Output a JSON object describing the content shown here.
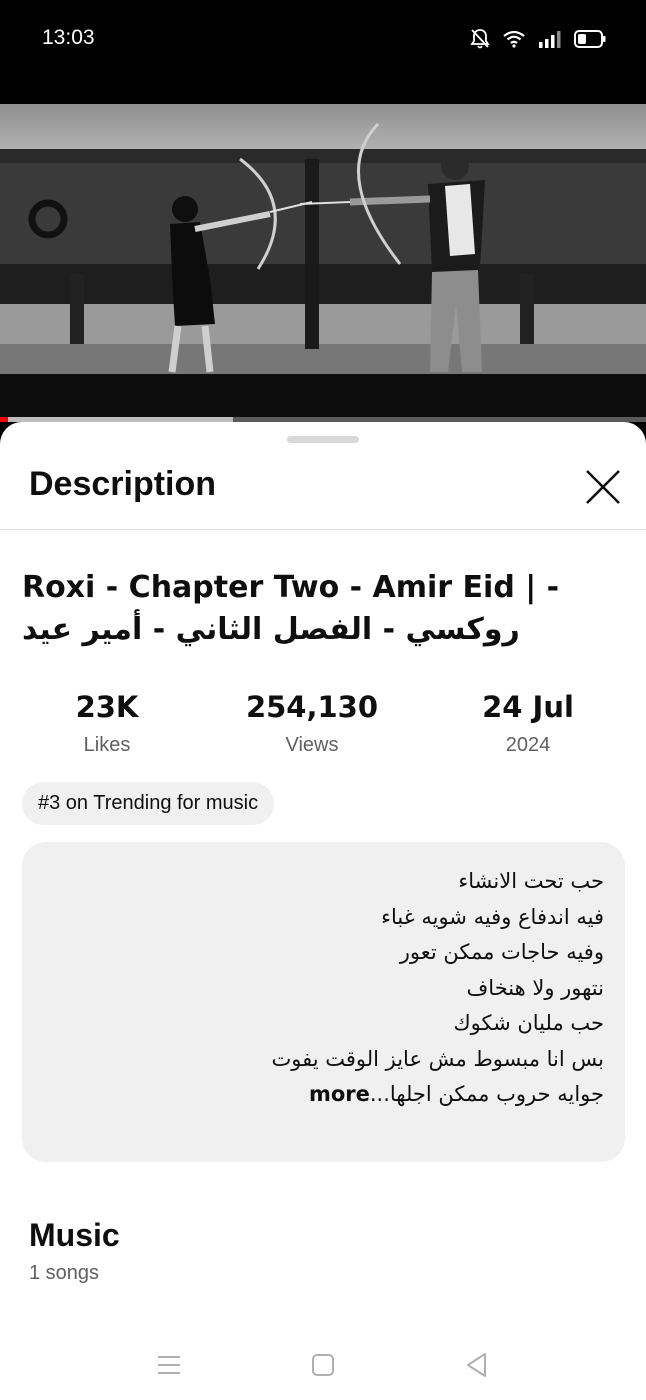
{
  "status_bar": {
    "time": "13:03",
    "icons": [
      "bell-muted-icon",
      "wifi-icon",
      "signal-icon",
      "battery-icon"
    ]
  },
  "video": {
    "progress_percent": 1.2,
    "buffer_percent": 36
  },
  "sheet": {
    "title": "Description",
    "close_icon": "close-icon"
  },
  "video_details": {
    "title": "Roxi - Chapter Two - Amir Eid | - روكسي - الفصل الثاني - أمير عيد",
    "stats": [
      {
        "value": "23K",
        "label": "Likes"
      },
      {
        "value": "254,130",
        "label": "Views"
      },
      {
        "value": "24 Jul",
        "label": "2024"
      }
    ],
    "trending_chip": "#3 on Trending for music"
  },
  "description": {
    "lines": [
      "حب تحت الانشاء",
      "فيه اندفاع وفيه شويه غباء",
      "وفيه حاجات ممكن تعور",
      "نتهور ولا هنخاف",
      "حب مليان شكوك",
      "بس انا مبسوط مش عايز الوقت يفوت"
    ],
    "last_line": "جوايه حروب ممكن اجلها...",
    "more_label": "more"
  },
  "music_section": {
    "title": "Music",
    "subtitle": "1 songs"
  },
  "nav_bar": {
    "buttons": [
      "menu-icon",
      "home-icon",
      "back-icon"
    ]
  },
  "colors": {
    "progress": "#ff0000",
    "chip_bg": "#f0f0f0",
    "text_primary": "#0f0f0f",
    "text_secondary": "#606060"
  }
}
